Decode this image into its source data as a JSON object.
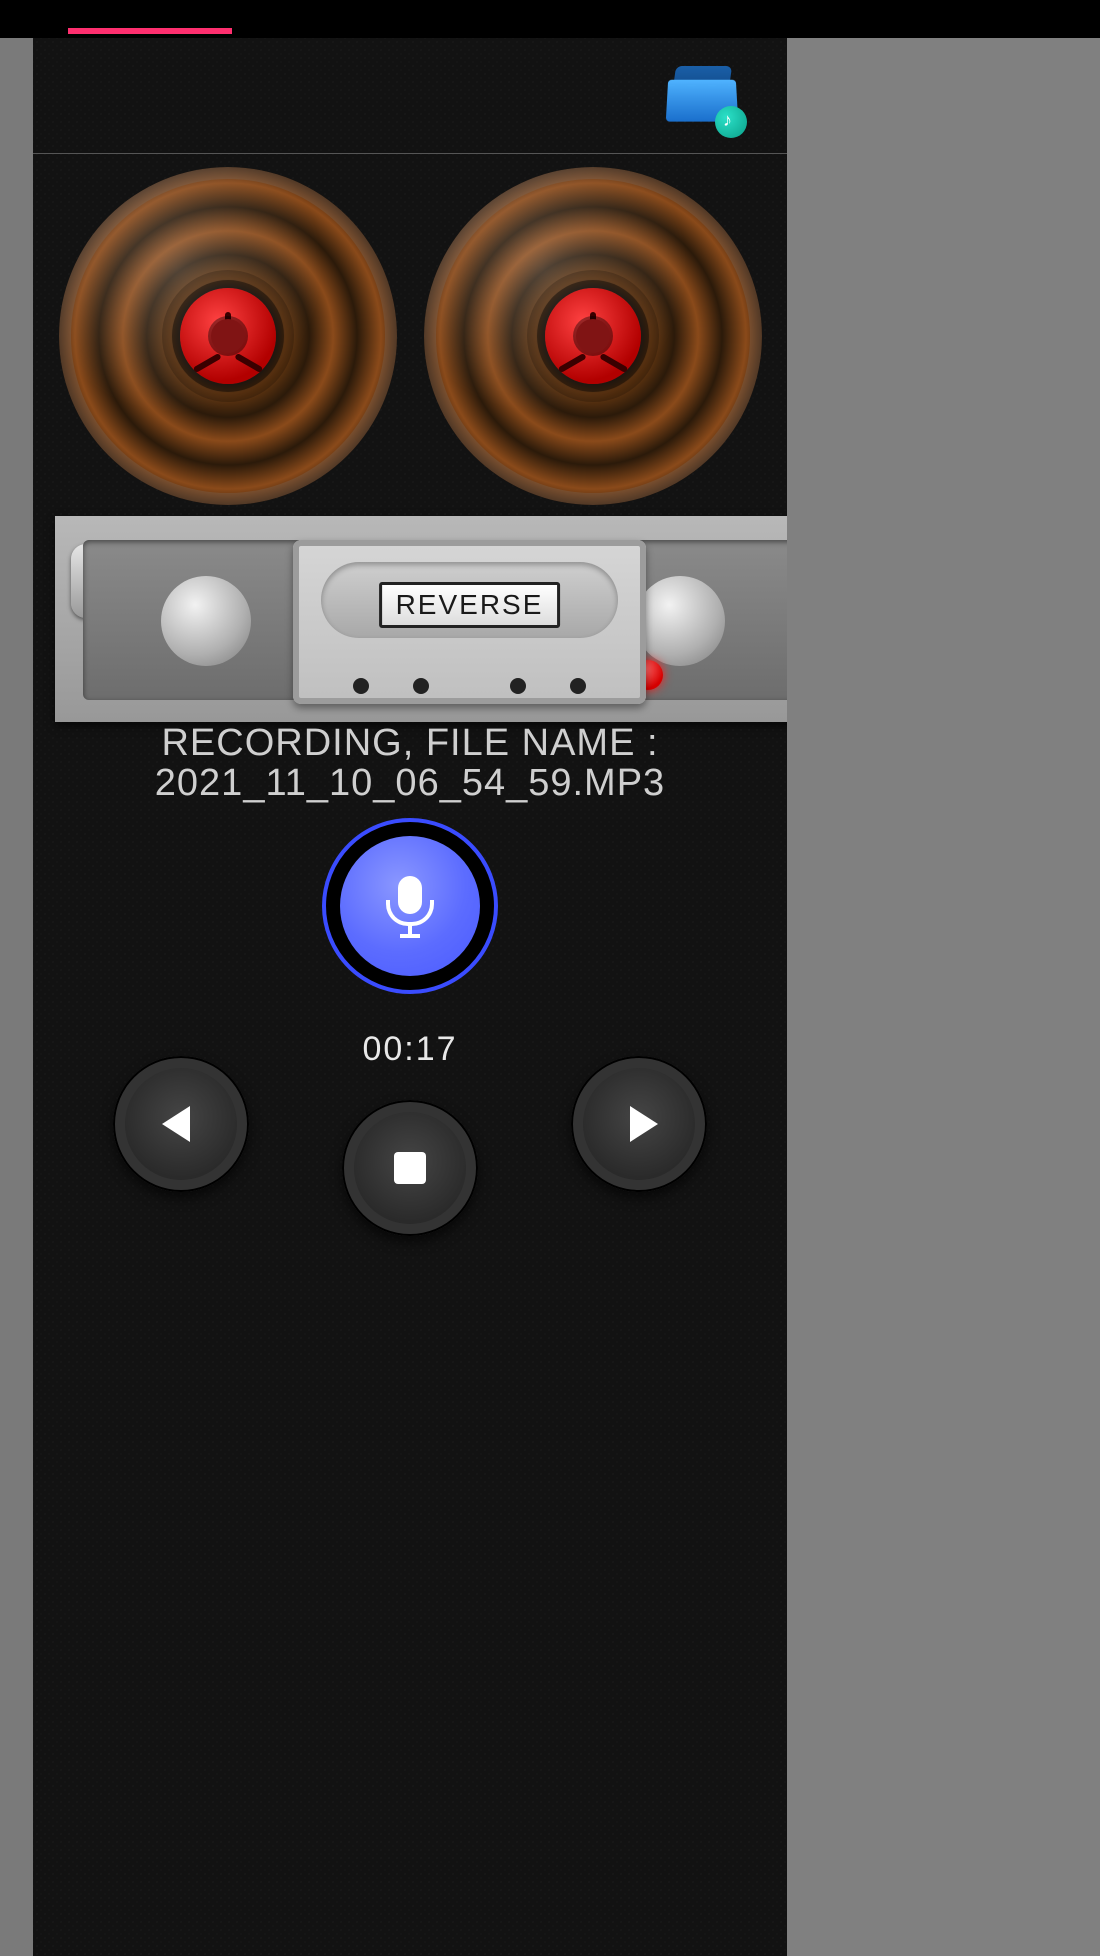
{
  "cassette": {
    "label": "REVERSE"
  },
  "status": {
    "line1": "RECORDING, FILE NAME :",
    "line2": "2021_11_10_06_54_59.MP3"
  },
  "timer": {
    "elapsed": "00:17"
  },
  "icons": {
    "folder": "recordings-folder",
    "mic": "microphone",
    "rewind": "rewind",
    "play": "play",
    "stop": "stop"
  },
  "colors": {
    "accent_pink": "#ff2f6f",
    "mic_blue": "#5c6cff",
    "record_red": "#d60000"
  }
}
